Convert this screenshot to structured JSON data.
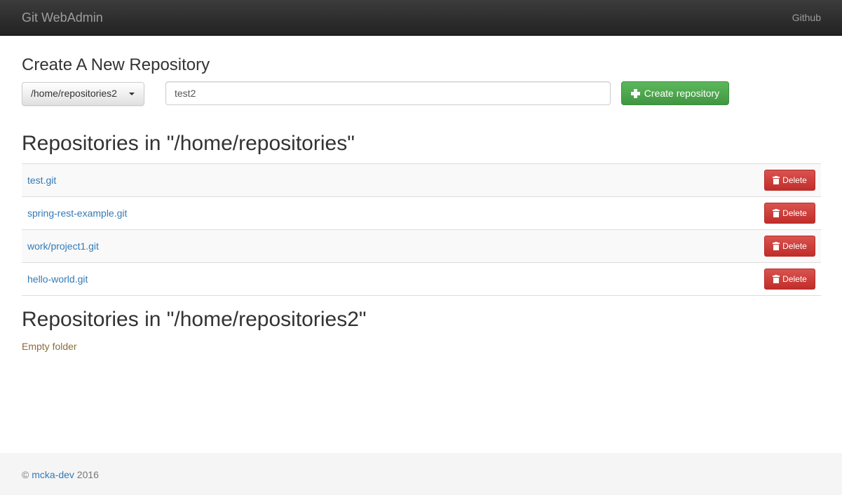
{
  "navbar": {
    "brand": "Git WebAdmin",
    "links": [
      "Github"
    ]
  },
  "create_form": {
    "title": "Create A New Repository",
    "folder_selected": "/home/repositories2",
    "name_value": "test2",
    "create_label": "Create repository"
  },
  "sections": [
    {
      "title": "Repositories in \"/home/repositories\"",
      "repos": [
        {
          "name": "test.git",
          "action": "Delete"
        },
        {
          "name": "spring-rest-example.git",
          "action": "Delete"
        },
        {
          "name": "work/project1.git",
          "action": "Delete"
        },
        {
          "name": "hello-world.git",
          "action": "Delete"
        }
      ]
    },
    {
      "title": "Repositories in \"/home/repositories2\"",
      "empty_text": "Empty folder"
    }
  ],
  "footer": {
    "prefix": "©",
    "author": "mcka-dev",
    "year": "2016"
  },
  "colors": {
    "navbar_bg": "#222222",
    "link": "#337ab7",
    "create_button": "#5cb85c",
    "delete_button": "#d9534f",
    "empty_text": "#8a6d3b",
    "footer_bg": "#f5f5f5"
  }
}
